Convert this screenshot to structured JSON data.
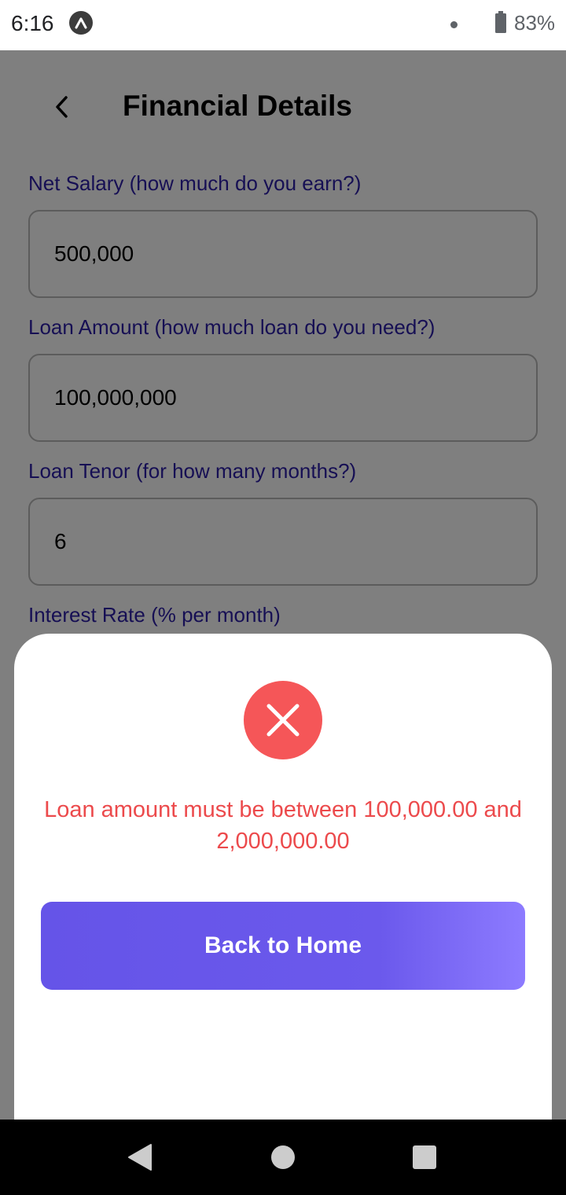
{
  "status_bar": {
    "time": "6:16",
    "battery_percent": "83%"
  },
  "header": {
    "title": "Financial Details",
    "back_icon": "chevron-left-icon"
  },
  "form": {
    "fields": [
      {
        "label": "Net Salary (how much do you earn?)",
        "value": "500,000"
      },
      {
        "label": "Loan Amount (how much loan do you need?)",
        "value": "100,000,000"
      },
      {
        "label": "Loan Tenor (for how many months?)",
        "value": "6"
      },
      {
        "label": "Interest Rate (% per month)"
      }
    ]
  },
  "modal": {
    "icon": "error-x-icon",
    "message": "Loan amount must be between 100,000.00 and 2,000,000.00",
    "button_label": "Back to Home"
  },
  "colors": {
    "label": "#2d1ea8",
    "error": "#f55658",
    "button": "#6b59ec"
  }
}
